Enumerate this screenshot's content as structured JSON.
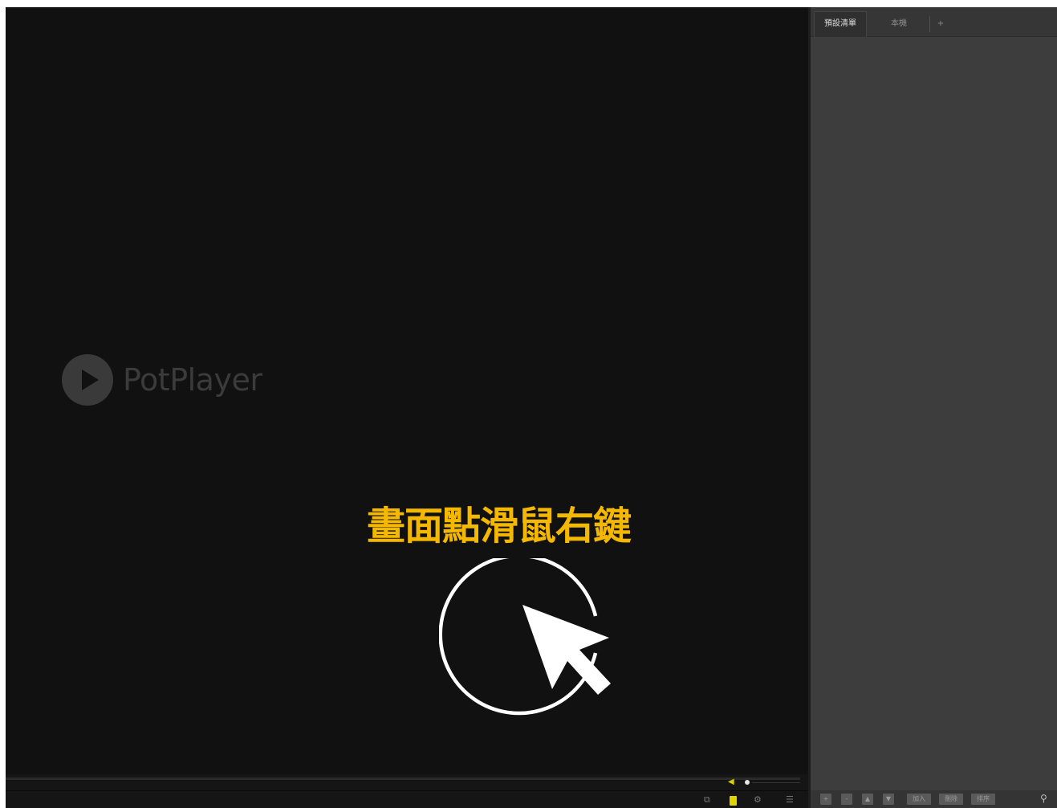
{
  "app": {
    "name": "PotPlayer"
  },
  "video": {
    "logo_text": "PotPlayer",
    "annotation": "畫面點滑鼠右鍵",
    "annotation_color": "#f5b800"
  },
  "playlist": {
    "tabs": [
      {
        "label": "預設清單",
        "active": true
      },
      {
        "label": "本機",
        "active": false
      },
      {
        "label": "+",
        "active": false
      }
    ],
    "toolbar_buttons": [
      "+",
      "-",
      "▲",
      "▼",
      "加入",
      "刪除",
      "排序"
    ]
  },
  "icons": {
    "logo": "play-circle-icon",
    "cursor": "mouse-pointer-icon",
    "volume": "speaker-icon",
    "subtitle": "subtitle-icon",
    "bookmark": "bookmark-icon",
    "settings": "gear-icon",
    "menu": "menu-icon",
    "search": "search-icon"
  }
}
